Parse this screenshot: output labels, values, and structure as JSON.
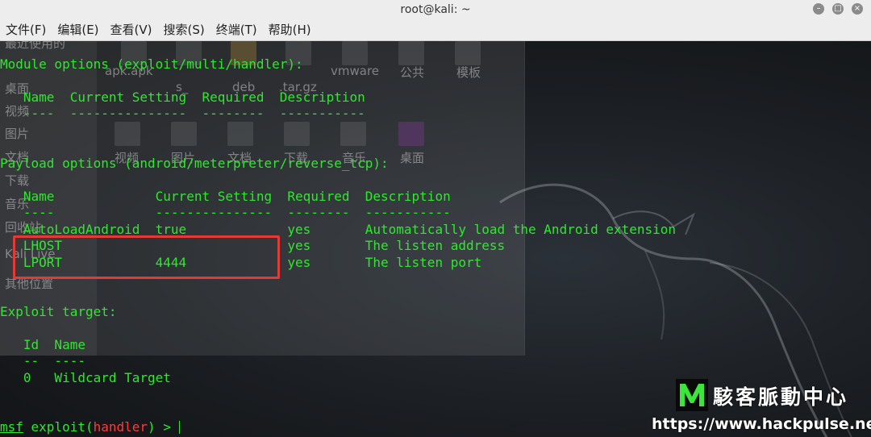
{
  "window": {
    "title": "root@kali: ~",
    "controls": [
      "–",
      "□",
      "×"
    ]
  },
  "menu": [
    {
      "label": "文件(F)"
    },
    {
      "label": "编辑(E)"
    },
    {
      "label": "查看(V)"
    },
    {
      "label": "搜索(S)"
    },
    {
      "label": "终端(T)"
    },
    {
      "label": "帮助(H)"
    }
  ],
  "background_filemanager": {
    "sidebar": [
      "最近使用的",
      "桌面",
      "视频",
      "图片",
      "文档",
      "下载",
      "音乐",
      "回收站",
      "Kali Live",
      "其他位置"
    ],
    "files_row1": [
      "apk.apk",
      "s_",
      "deb",
      ".tar.gz",
      "vmware",
      "公共",
      "模板"
    ],
    "files_row2": [
      "视频",
      "图片",
      "文档",
      "下载",
      "音乐",
      "桌面"
    ]
  },
  "terminal": {
    "module_header": "Module options (exploit/multi/handler):",
    "module_cols": "   Name  Current Setting  Required  Description",
    "module_dash": "   ----  ---------------  --------  -----------",
    "payload_header": "Payload options (android/meterpreter/reverse_tcp):",
    "payload_cols": "   Name             Current Setting  Required  Description",
    "payload_dash": "   ----             ---------------  --------  -----------",
    "payload_rows": [
      "   AutoLoadAndroid  true             yes       Automatically load the Android extension",
      "   LHOST                             yes       The listen address",
      "   LPORT            4444             yes       The listen port"
    ],
    "target_header": "Exploit target:",
    "target_cols": "   Id  Name",
    "target_dash": "   --  ----",
    "target_row": "   0   Wildcard Target",
    "prompt_msf": "msf",
    "prompt_exploit": " exploit(",
    "prompt_module": "handler",
    "prompt_end": ") > "
  },
  "watermark": {
    "title": "駭客脈動中心",
    "url": "https://www.hackpulse.net"
  },
  "colors": {
    "terminal_green": "#2ee82e",
    "highlight_red": "#e53935",
    "prompt_red": "#ff3a3a",
    "titlebar": "#ededed"
  }
}
